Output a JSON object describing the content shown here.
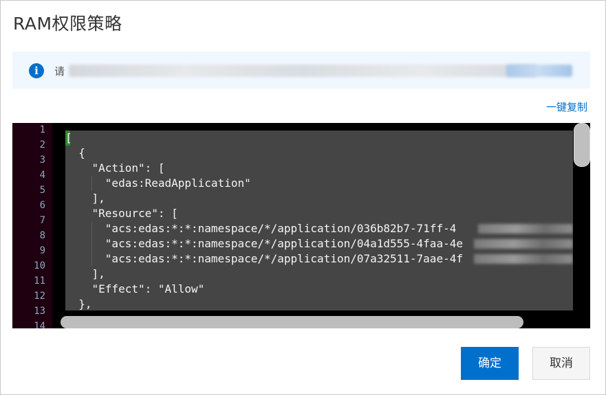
{
  "dialog": {
    "title": "RAM权限策略",
    "notice": {
      "visible_prefix": "请"
    },
    "copy_link": "一键复制",
    "buttons": {
      "confirm": "确定",
      "cancel": "取消"
    }
  },
  "editor": {
    "line_numbers": [
      "1",
      "2",
      "3",
      "4",
      "5",
      "6",
      "7",
      "8",
      "9",
      "10",
      "11",
      "12",
      "13",
      "14"
    ],
    "code": {
      "line1": "[",
      "line2": "  {",
      "line3": "    \"Action\": [",
      "line4": "      \"edas:ReadApplication\"",
      "line5": "    ],",
      "line6": "    \"Resource\": [",
      "line7": "      \"acs:edas:*:*:namespace/*/application/036b82b7-71ff-4",
      "line8": "      \"acs:edas:*:*:namespace/*/application/04a1d555-4faa-4e",
      "line9": "      \"acs:edas:*:*:namespace/*/application/07a32511-7aae-4f",
      "line10": "    ],",
      "line11": "    \"Effect\": \"Allow\"",
      "line12": "  },"
    }
  },
  "colors": {
    "primary": "#0070cc",
    "notice_bg": "#f1f7ff",
    "editor_bg": "#000000",
    "code_bg": "#454545"
  }
}
